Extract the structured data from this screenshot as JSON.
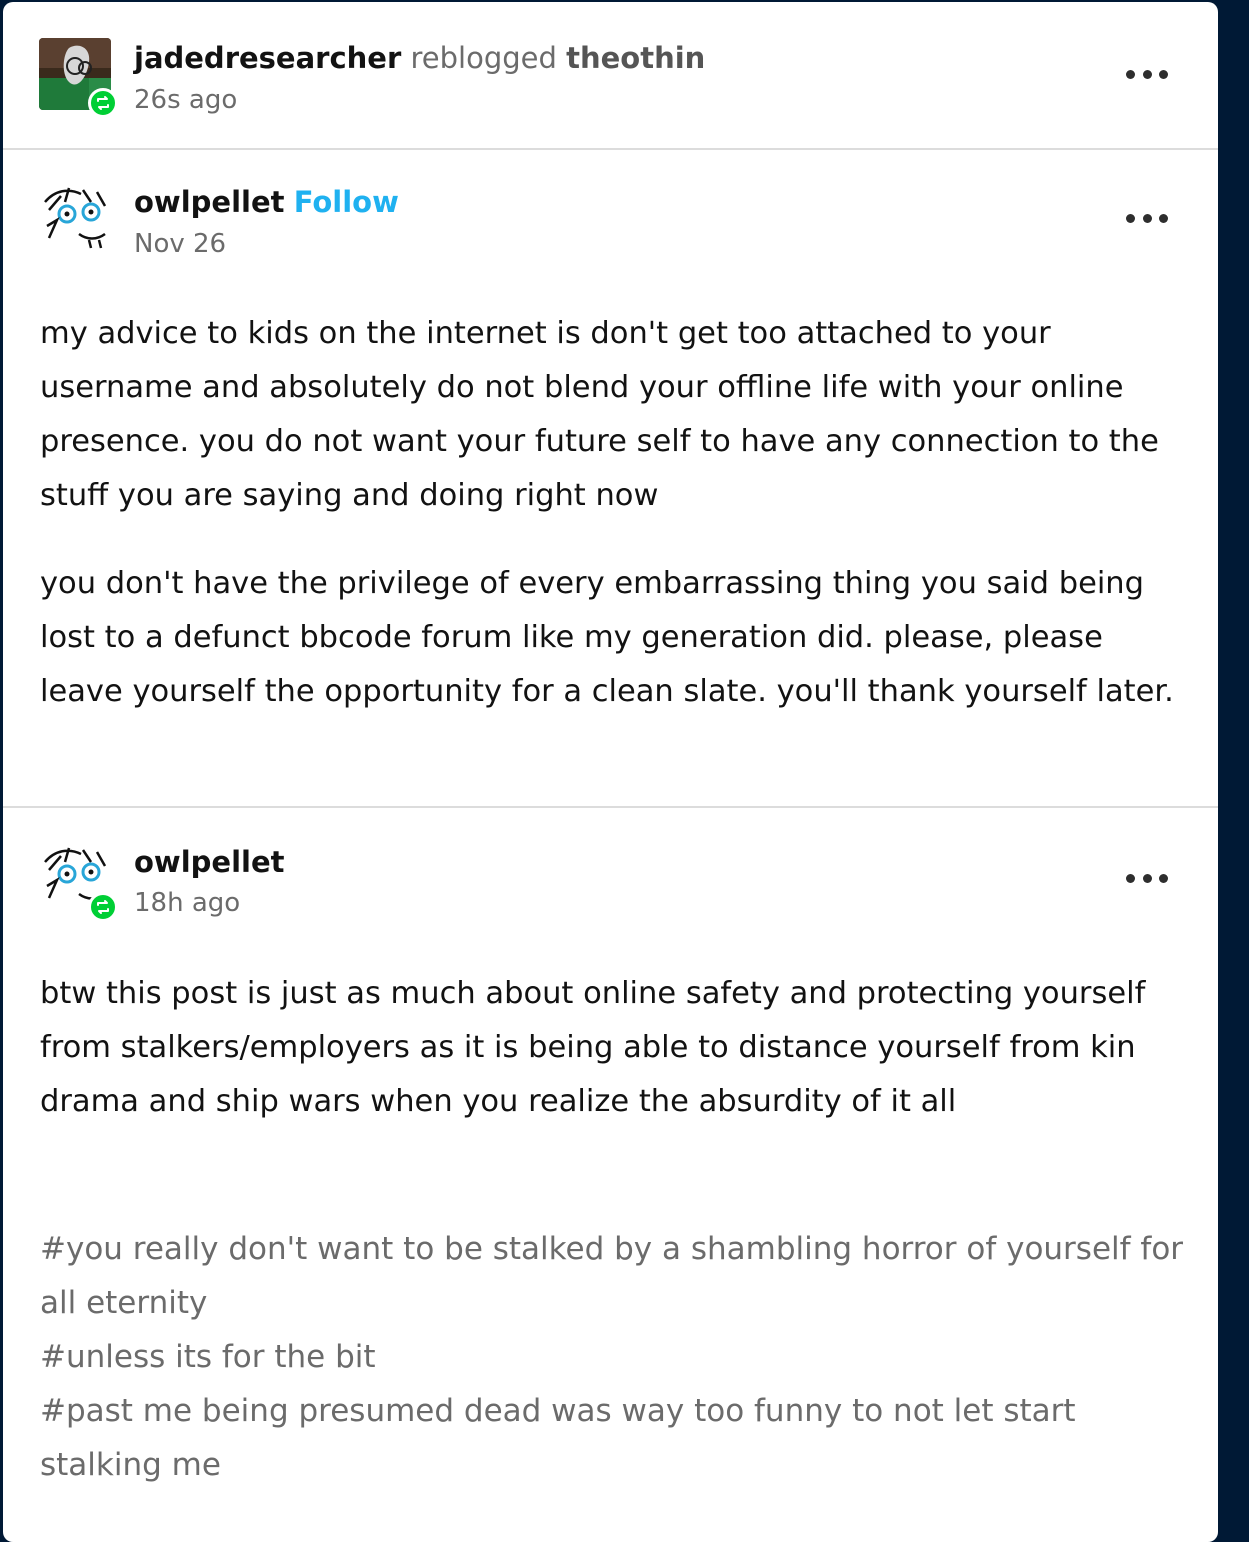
{
  "header": {
    "reblogger": "jadedresearcher",
    "action": "reblogged",
    "source": "theothin",
    "time": "26s ago"
  },
  "post1": {
    "author": "owlpellet",
    "follow_label": "Follow",
    "date": "Nov 26",
    "paragraphs": [
      "my advice to kids on the internet is don't get too attached to your username and absolutely do not blend your offline life with your online presence. you do not want your future self to have any connection to the stuff you are saying and doing right now",
      "you don't have the privilege of every embarrassing thing you said being lost to a defunct bbcode forum like my generation did. please, please leave yourself the opportunity for a clean slate. you'll thank yourself later."
    ]
  },
  "post2": {
    "author": "owlpellet",
    "time": "18h ago",
    "paragraphs": [
      "btw this post is just as much about online safety and protecting yourself from stalkers/employers as it is being able to distance yourself from kin drama and ship wars when you realize the absurdity of it all"
    ],
    "tags": [
      "#you really don't want to be stalked by a shambling horror of yourself for all eternity",
      "#unless its for the bit",
      "#past me being presumed dead was way too funny to not let start stalking me"
    ]
  },
  "icons": {
    "reblog_badge": "reblog-icon",
    "more": "more-options-icon"
  },
  "colors": {
    "background": "#001935",
    "follow": "#1fb1f0",
    "reblog_badge": "#00cf35"
  }
}
